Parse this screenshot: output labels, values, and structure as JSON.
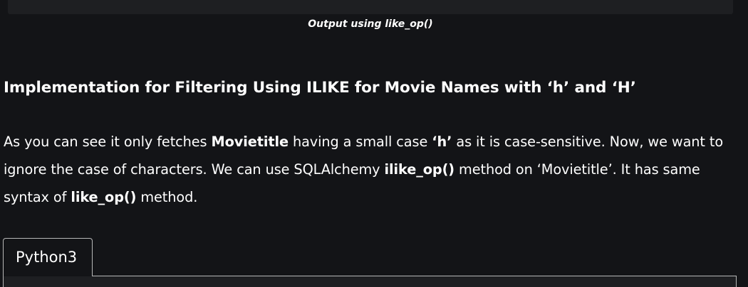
{
  "caption": "Output using like_op()",
  "heading": "Implementation for Filtering Using ILIKE for Movie Names with ‘h’ and ‘H’",
  "paragraph": {
    "t1": "As you can see it only fetches ",
    "b1": "Movietitle",
    "t2": " having a small case ",
    "b2": "‘h’",
    "t3": " as it is case-sensitive. Now, we want to ignore the case of characters. We can use SQLAlchemy ",
    "b3": "ilike_op()",
    "t4": " method on ‘Movietitle’. It has same syntax of ",
    "b4": "like_op()",
    "t5": " method."
  },
  "code_tab": {
    "label": "Python3"
  }
}
